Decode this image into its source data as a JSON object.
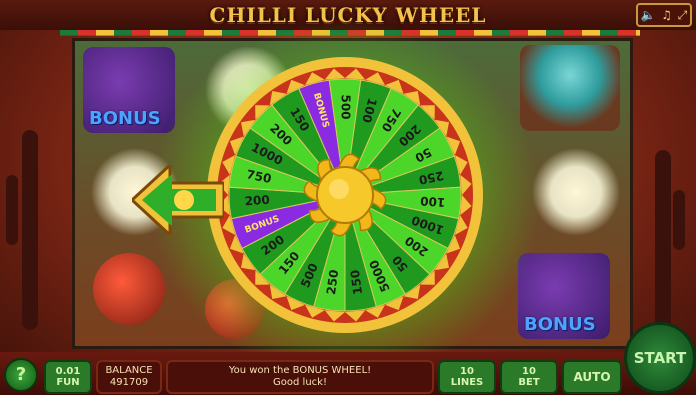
{
  "header": {
    "title": "CHILLI LUCKY WHEEL"
  },
  "settings_icons": [
    "speaker-icon",
    "music-note-icon",
    "fullscreen-icon"
  ],
  "reels": {
    "bonus_label": "BONUS"
  },
  "wheel": {
    "segments": [
      "500",
      "100",
      "750",
      "200",
      "50",
      "250",
      "100",
      "1000",
      "200",
      "50",
      "5000",
      "150",
      "250",
      "500",
      "150",
      "200",
      "BONUS",
      "200",
      "750",
      "1000",
      "200",
      "150",
      "BONUS"
    ],
    "colors": {
      "green_dark": "#1f9a1f",
      "green_light": "#4cd62a",
      "purple": "#8a2be2",
      "rim": "#c8331c",
      "gold": "#f2c23a"
    },
    "center_icon": "sun-icon"
  },
  "pointer": {
    "icon": "sun-arrow-pointer-icon"
  },
  "bottom": {
    "help": "?",
    "coin_value": "0.01",
    "coin_label": "FUN",
    "balance_label": "BALANCE",
    "balance_value": "491709",
    "message_line1": "You won the BONUS WHEEL!",
    "message_line2": "Good luck!",
    "lines_value": "10",
    "lines_label": "LINES",
    "bet_value": "10",
    "bet_label": "BET",
    "auto_label": "AUTO",
    "start_label": "START"
  }
}
